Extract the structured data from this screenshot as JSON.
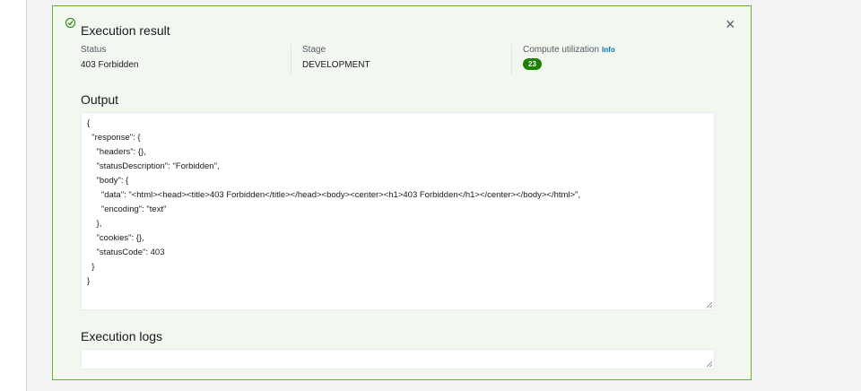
{
  "panel": {
    "title": "Execution result",
    "close_label": "×"
  },
  "summary": {
    "status": {
      "label": "Status",
      "value": "403 Forbidden"
    },
    "stage": {
      "label": "Stage",
      "value": "DEVELOPMENT"
    },
    "compute": {
      "label": "Compute utilization",
      "info": "Info",
      "value": "23"
    }
  },
  "output": {
    "heading": "Output",
    "lines": [
      "{",
      "  \"response\": {",
      "    \"headers\": {},",
      "    \"statusDescription\": \"Forbidden\",",
      "    \"body\": {",
      "      \"data\": \"<html><head><title>403 Forbidden</title></head><body><center><h1>403 Forbidden</h1></center></body></html>\",",
      "      \"encoding\": \"text\"",
      "    },",
      "    \"cookies\": {},",
      "    \"statusCode\": 403",
      "  }",
      "}"
    ]
  },
  "logs": {
    "heading": "Execution logs",
    "value": ""
  },
  "colors": {
    "success": "#1d8102",
    "link": "#0073bb",
    "panel_bg": "#f2f8f0"
  }
}
